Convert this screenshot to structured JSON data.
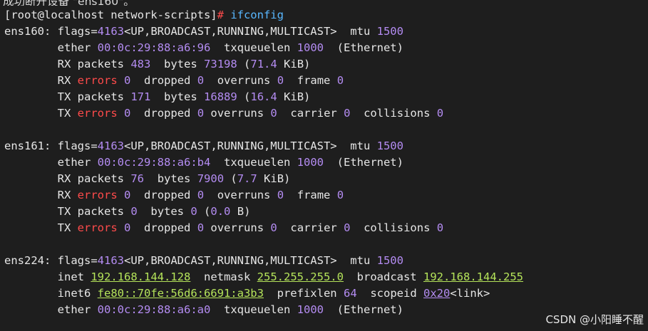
{
  "top_fragment": "成功断开设备 \"ens160\"。",
  "prompt": "[root@localhost network-scripts]",
  "prompt_symbol": "#",
  "command": "ifconfig",
  "ens160": {
    "name": "ens160",
    "flags_label": "flags=",
    "flags_value": "4163",
    "flags_text": "<UP,BROADCAST,RUNNING,MULTICAST>",
    "mtu_label": "mtu",
    "mtu": "1500",
    "ether_label": "ether",
    "mac": "00:0c:29:88:a6:96",
    "txq_label": "txqueuelen",
    "txq": "1000",
    "link_type": "(Ethernet)",
    "rx_packets": "483",
    "rx_bytes": "73198",
    "rx_human_num": "71.4",
    "rx_human_unit": "KiB",
    "rx_errors": "0",
    "rx_dropped": "0",
    "rx_overruns": "0",
    "rx_frame": "0",
    "tx_packets": "171",
    "tx_bytes": "16889",
    "tx_human_num": "16.4",
    "tx_human_unit": "KiB",
    "tx_errors": "0",
    "tx_dropped": "0",
    "tx_overruns": "0",
    "tx_carrier": "0",
    "tx_collisions": "0"
  },
  "ens161": {
    "name": "ens161",
    "flags_label": "flags=",
    "flags_value": "4163",
    "flags_text": "<UP,BROADCAST,RUNNING,MULTICAST>",
    "mtu_label": "mtu",
    "mtu": "1500",
    "ether_label": "ether",
    "mac": "00:0c:29:88:a6:b4",
    "txq_label": "txqueuelen",
    "txq": "1000",
    "link_type": "(Ethernet)",
    "rx_packets": "76",
    "rx_bytes": "7900",
    "rx_human_num": "7.7",
    "rx_human_unit": "KiB",
    "rx_errors": "0",
    "rx_dropped": "0",
    "rx_overruns": "0",
    "rx_frame": "0",
    "tx_packets": "0",
    "tx_bytes": "0",
    "tx_human_num": "0.0",
    "tx_human_unit": "B",
    "tx_errors": "0",
    "tx_dropped": "0",
    "tx_overruns": "0",
    "tx_carrier": "0",
    "tx_collisions": "0"
  },
  "ens224": {
    "name": "ens224",
    "flags_label": "flags=",
    "flags_value": "4163",
    "flags_text": "<UP,BROADCAST,RUNNING,MULTICAST>",
    "mtu_label": "mtu",
    "mtu": "1500",
    "inet_label": "inet",
    "inet": "192.168.144.128",
    "netmask_label": "netmask",
    "netmask": "255.255.255.0",
    "broadcast_label": "broadcast",
    "broadcast": "192.168.144.255",
    "inet6_label": "inet6",
    "inet6": "fe80::70fe:56d6:6691:a3b3",
    "prefixlen_label": "prefixlen",
    "prefixlen": "64",
    "scopeid_label": "scopeid",
    "scopeid": "0x20",
    "scope_text": "<link>",
    "ether_label": "ether",
    "mac": "00:0c:29:88:a6:a0",
    "txq_label": "txqueuelen",
    "txq": "1000",
    "link_type": "(Ethernet)"
  },
  "labels": {
    "rx": "RX",
    "tx": "TX",
    "packets": "packets",
    "bytes": "bytes",
    "errors": "errors",
    "dropped": "dropped",
    "overruns": "overruns",
    "frame": "frame",
    "carrier": "carrier",
    "collisions": "collisions"
  },
  "watermark": "CSDN @小阳睡不醒",
  "colors": {
    "background": "#1e1e1e",
    "text": "#e6e6e6",
    "number": "#b48cf2",
    "error": "#ff4b4b",
    "ip": "#b5e45a",
    "command": "#58b7ff"
  }
}
